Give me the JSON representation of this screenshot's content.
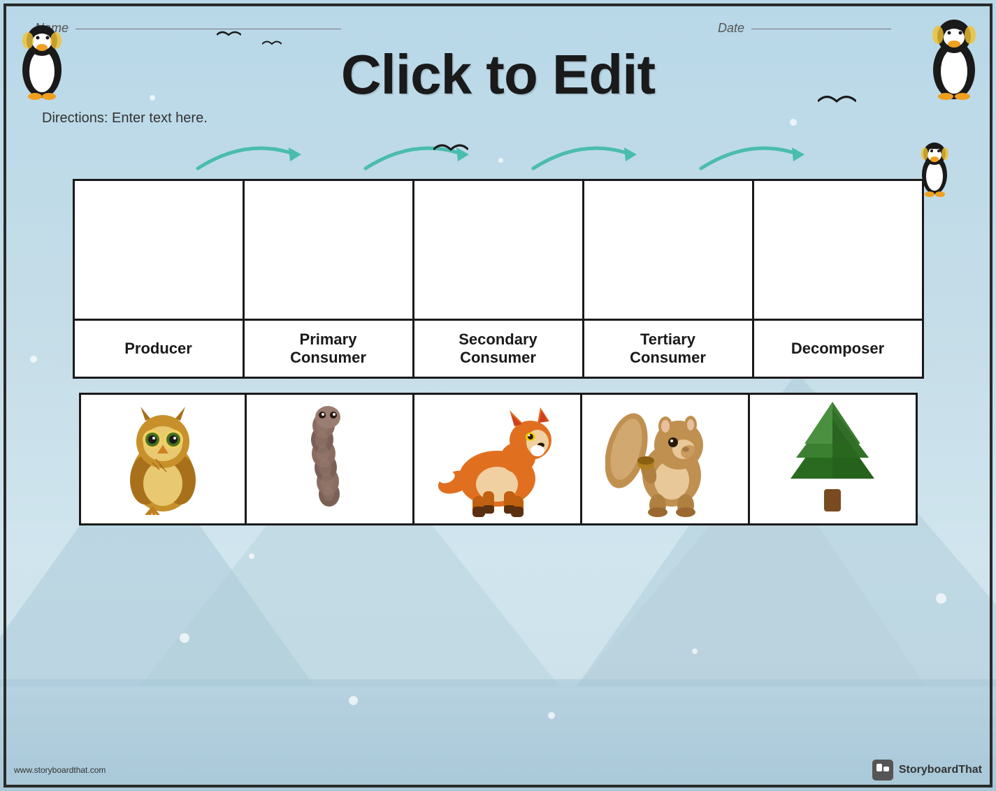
{
  "page": {
    "title": "Click to Edit",
    "name_label": "Name",
    "date_label": "Date",
    "directions": "Directions: Enter text here."
  },
  "labels": {
    "producer": "Producer",
    "primary_consumer": "Primary\nConsumer",
    "secondary_consumer": "Secondary\nConsumer",
    "tertiary_consumer": "Tertiary\nConsumer",
    "decomposer": "Decomposer"
  },
  "footer": {
    "url": "www.storyboardthat.com",
    "brand": "StoryboardThat"
  },
  "colors": {
    "background": "#c8dfe8",
    "border": "#1a1a1a",
    "arrow": "#4abcb0",
    "title": "#1a1a1a"
  }
}
